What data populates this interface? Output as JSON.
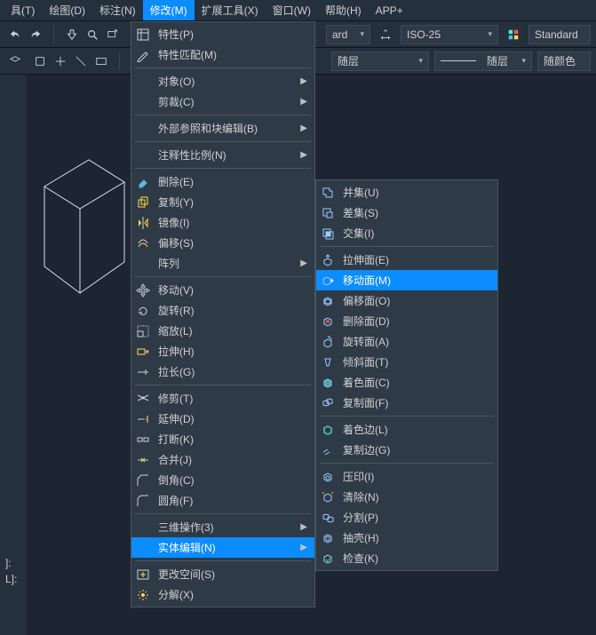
{
  "menubar": {
    "items": [
      {
        "label": "具(T)"
      },
      {
        "label": "绘图(D)"
      },
      {
        "label": "标注(N)"
      },
      {
        "label": "修改(M)",
        "active": true
      },
      {
        "label": "扩展工具(X)"
      },
      {
        "label": "窗口(W)"
      },
      {
        "label": "帮助(H)"
      },
      {
        "label": "APP+"
      }
    ]
  },
  "toolbar": {
    "dim_style": "ISO-25",
    "text_style": "Standard",
    "layer1": "随层",
    "layer2": "随层",
    "color": "随颜色"
  },
  "menu1": [
    {
      "type": "item",
      "icon": "properties",
      "label": "特性(P)"
    },
    {
      "type": "item",
      "icon": "matchprop",
      "label": "特性匹配(M)"
    },
    {
      "type": "divider"
    },
    {
      "type": "sub",
      "label": "对象(O)"
    },
    {
      "type": "sub",
      "label": "剪裁(C)"
    },
    {
      "type": "divider"
    },
    {
      "type": "sub",
      "label": "外部参照和块编辑(B)"
    },
    {
      "type": "divider"
    },
    {
      "type": "sub",
      "label": "注释性比例(N)"
    },
    {
      "type": "divider"
    },
    {
      "type": "item",
      "icon": "erase",
      "label": "删除(E)"
    },
    {
      "type": "item",
      "icon": "copy",
      "label": "复制(Y)"
    },
    {
      "type": "item",
      "icon": "mirror",
      "label": "镜像(I)"
    },
    {
      "type": "item",
      "icon": "offset",
      "label": "偏移(S)"
    },
    {
      "type": "sub",
      "label": "阵列"
    },
    {
      "type": "divider"
    },
    {
      "type": "item",
      "icon": "move",
      "label": "移动(V)"
    },
    {
      "type": "item",
      "icon": "rotate",
      "label": "旋转(R)"
    },
    {
      "type": "item",
      "icon": "scale",
      "label": "缩放(L)"
    },
    {
      "type": "item",
      "icon": "stretch",
      "label": "拉伸(H)"
    },
    {
      "type": "item",
      "icon": "lengthen",
      "label": "拉长(G)"
    },
    {
      "type": "divider"
    },
    {
      "type": "item",
      "icon": "trim",
      "label": "修剪(T)"
    },
    {
      "type": "item",
      "icon": "extend",
      "label": "延伸(D)"
    },
    {
      "type": "item",
      "icon": "break",
      "label": "打断(K)"
    },
    {
      "type": "item",
      "icon": "join",
      "label": "合并(J)"
    },
    {
      "type": "item",
      "icon": "chamfer",
      "label": "倒角(C)"
    },
    {
      "type": "item",
      "icon": "fillet",
      "label": "圆角(F)"
    },
    {
      "type": "divider"
    },
    {
      "type": "sub",
      "label": "三维操作(3)"
    },
    {
      "type": "sub",
      "label": "实体编辑(N)",
      "highlight": true
    },
    {
      "type": "divider"
    },
    {
      "type": "item",
      "icon": "chspace",
      "label": "更改空间(S)"
    },
    {
      "type": "item",
      "icon": "explode",
      "label": "分解(X)"
    }
  ],
  "menu2": [
    {
      "type": "item",
      "icon": "union",
      "label": "并集(U)"
    },
    {
      "type": "item",
      "icon": "subtract",
      "label": "差集(S)"
    },
    {
      "type": "item",
      "icon": "intersect",
      "label": "交集(I)"
    },
    {
      "type": "divider"
    },
    {
      "type": "item",
      "icon": "extrudef",
      "label": "拉伸面(E)"
    },
    {
      "type": "item",
      "icon": "movef",
      "label": "移动面(M)",
      "highlight": true
    },
    {
      "type": "item",
      "icon": "offsetf",
      "label": "偏移面(O)"
    },
    {
      "type": "item",
      "icon": "deletef",
      "label": "删除面(D)"
    },
    {
      "type": "item",
      "icon": "rotatef",
      "label": "旋转面(A)"
    },
    {
      "type": "item",
      "icon": "taperf",
      "label": "倾斜面(T)"
    },
    {
      "type": "item",
      "icon": "colorf",
      "label": "着色面(C)"
    },
    {
      "type": "item",
      "icon": "copyf",
      "label": "复制面(F)"
    },
    {
      "type": "divider"
    },
    {
      "type": "item",
      "icon": "colore",
      "label": "着色边(L)"
    },
    {
      "type": "item",
      "icon": "copye",
      "label": "复制边(G)"
    },
    {
      "type": "divider"
    },
    {
      "type": "item",
      "icon": "imprint",
      "label": "压印(I)"
    },
    {
      "type": "item",
      "icon": "clean",
      "label": "清除(N)"
    },
    {
      "type": "item",
      "icon": "separate",
      "label": "分割(P)"
    },
    {
      "type": "item",
      "icon": "shell",
      "label": "抽壳(H)"
    },
    {
      "type": "item",
      "icon": "check",
      "label": "检查(K)"
    }
  ],
  "cmd": {
    "l1": "]:",
    "l2": "L]:"
  }
}
